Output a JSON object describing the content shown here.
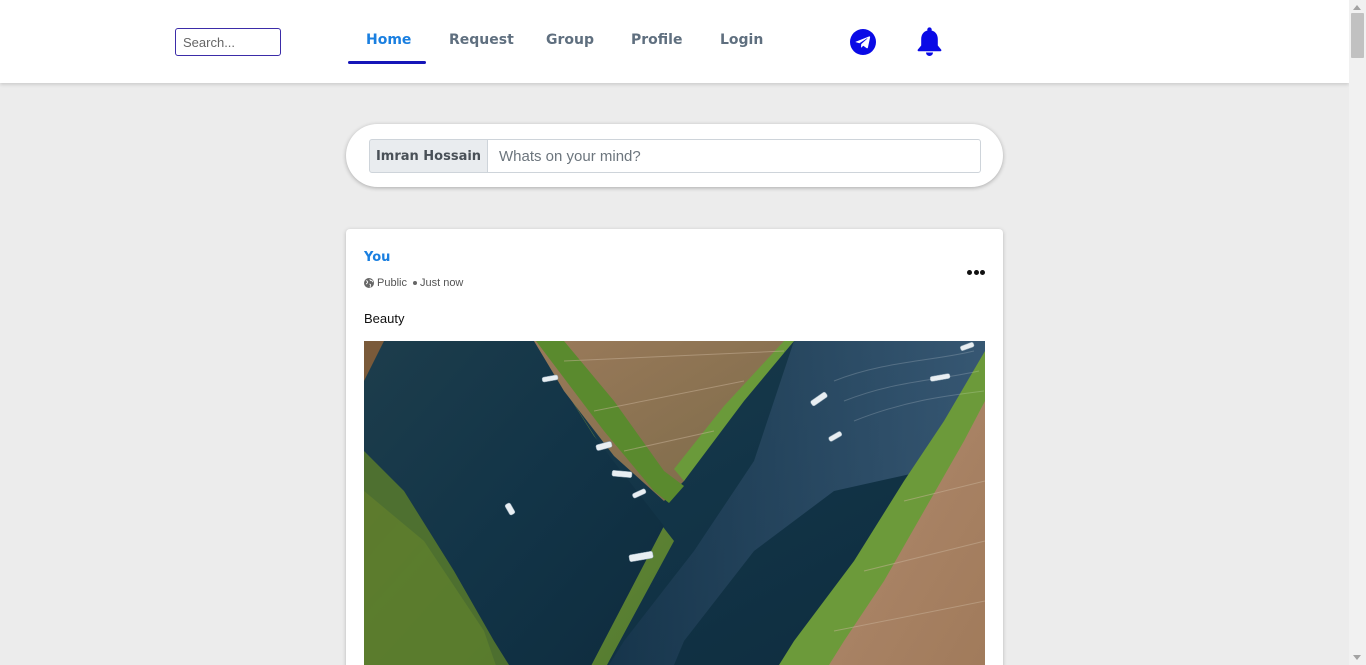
{
  "header": {
    "search_placeholder": "Search...",
    "nav": [
      {
        "label": "Home",
        "active": true
      },
      {
        "label": "Request",
        "active": false
      },
      {
        "label": "Group",
        "active": false
      },
      {
        "label": "Profile",
        "active": false
      },
      {
        "label": "Login",
        "active": false
      }
    ],
    "icons": [
      "telegram-icon",
      "bell-icon"
    ],
    "accent_color": "#1a7fe0",
    "icon_color": "#0a0ae6"
  },
  "composer": {
    "user_name": "Imran Hossain",
    "placeholder": "Whats on your mind?"
  },
  "post": {
    "author": "You",
    "visibility": "Public",
    "time": "Just now",
    "text": "Beauty",
    "image_icon": "aerial-river-photo"
  }
}
